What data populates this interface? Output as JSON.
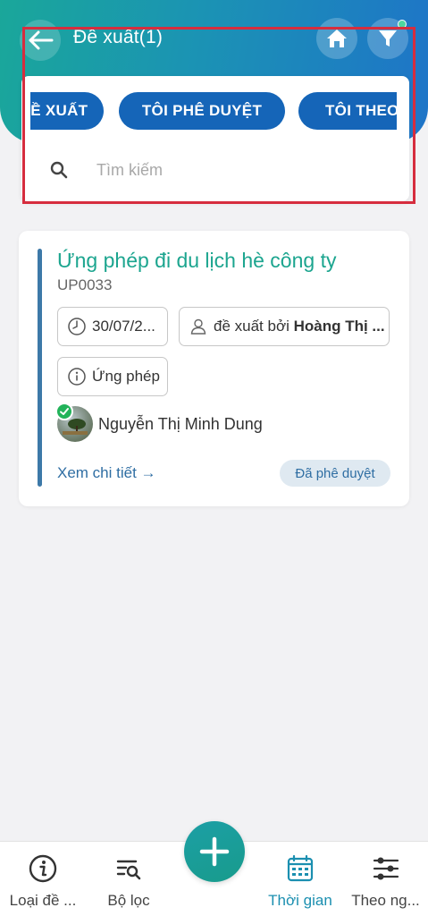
{
  "header": {
    "title": "Đề xuất(1)",
    "back_icon": "arrow-left-icon",
    "home_icon": "home-icon",
    "filter_icon": "filter-icon"
  },
  "tabs": [
    {
      "label": "ĐỀ XUẤT"
    },
    {
      "label": "TÔI PHÊ DUYỆT"
    },
    {
      "label": "TÔI THEO DÕI"
    }
  ],
  "search": {
    "placeholder": "Tìm kiếm",
    "value": ""
  },
  "request": {
    "title": "Ứng phép đi du lịch hè công ty",
    "code": "UP0033",
    "date": "30/07/2...",
    "author_prefix": "đề xuất bởi ",
    "author_name": "Hoàng Thị ...",
    "type": "Ứng phép",
    "assignee": "Nguyễn Thị Minh Dung",
    "detail_link": "Xem chi tiết →",
    "status": "Đã phê duyệt"
  },
  "bottom_nav": [
    {
      "label": "Loại đề ...",
      "icon": "info-icon"
    },
    {
      "label": "Bộ lọc",
      "icon": "filter-list-icon"
    },
    {
      "label": "Thời gian",
      "icon": "calendar-icon",
      "active": true
    },
    {
      "label": "Theo ng...",
      "icon": "sliders-icon"
    }
  ],
  "colors": {
    "accent": "#1565b8",
    "title_green": "#1ca58f",
    "highlight_red": "#d62d3e",
    "active_nav": "#1b8fb0"
  }
}
